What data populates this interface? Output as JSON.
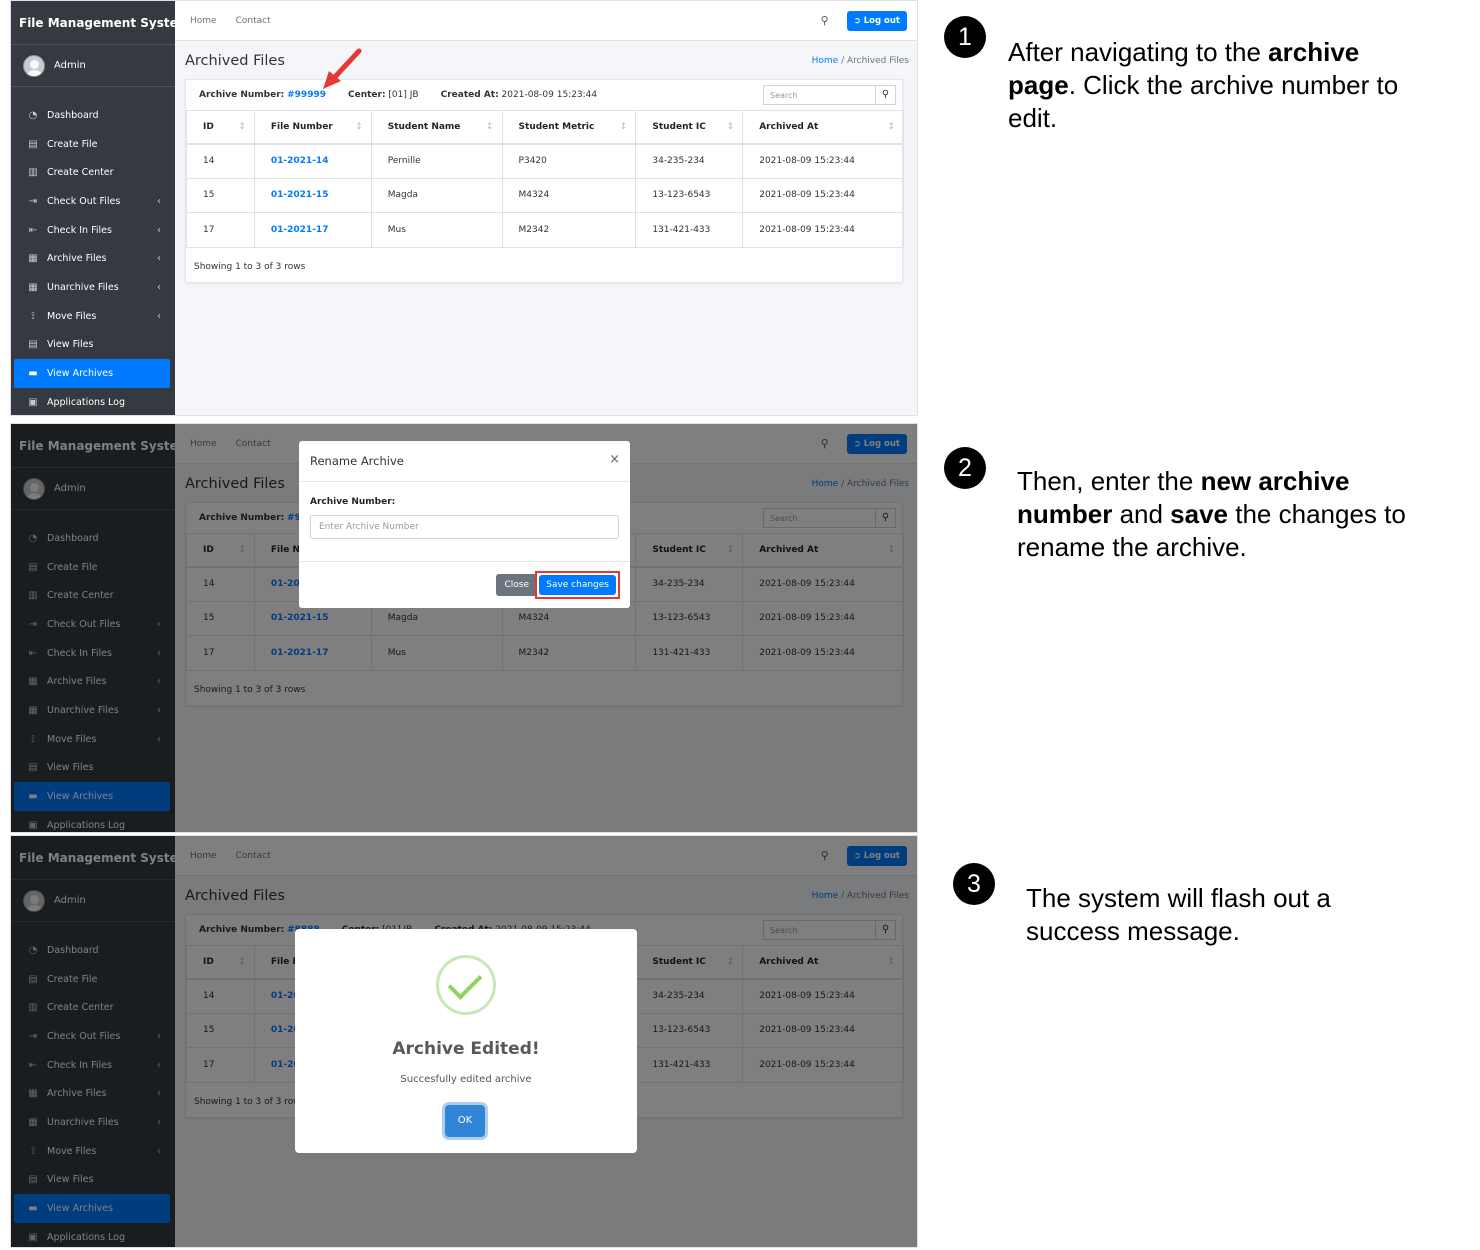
{
  "app": {
    "brand": "File Management System",
    "user": "Admin",
    "home": "Home",
    "contact": "Contact",
    "logout": "Log out"
  },
  "sidebar": [
    {
      "label": "Dashboard",
      "icon": "dashboard-icon",
      "chevron": false
    },
    {
      "label": "Create File",
      "icon": "file-icon",
      "chevron": false
    },
    {
      "label": "Create Center",
      "icon": "building-icon",
      "chevron": false
    },
    {
      "label": "Check Out Files",
      "icon": "file-export-icon",
      "chevron": true
    },
    {
      "label": "Check In Files",
      "icon": "file-import-icon",
      "chevron": true
    },
    {
      "label": "Archive Files",
      "icon": "file-archive-icon",
      "chevron": true
    },
    {
      "label": "Unarchive Files",
      "icon": "file-unarchive-icon",
      "chevron": true
    },
    {
      "label": "Move Files",
      "icon": "dolly-icon",
      "chevron": true
    },
    {
      "label": "View Files",
      "icon": "file-icon",
      "chevron": false
    },
    {
      "label": "View Archives",
      "icon": "archive-icon",
      "chevron": false
    },
    {
      "label": "Applications Log",
      "icon": "clipboard-icon",
      "chevron": false
    }
  ],
  "page": {
    "title": "Archived Files",
    "crumb_home": "Home",
    "crumb_sep": "/",
    "crumb_current": "Archived Files"
  },
  "archive": {
    "label": "Archive Number:",
    "number1": "#99999",
    "number3": "#8888",
    "center_label": "Center:",
    "center_value": "[01] JB",
    "created_label": "Created At:",
    "created_value": "2021-08-09 15:23:44"
  },
  "search": {
    "placeholder": "Search"
  },
  "table": {
    "headers": [
      "ID",
      "File Number",
      "Student Name",
      "Student Metric",
      "Student IC",
      "Archived At"
    ],
    "rows": [
      [
        "14",
        "01-2021-14",
        "Pernille",
        "P3420",
        "34-235-234",
        "2021-08-09 15:23:44"
      ],
      [
        "15",
        "01-2021-15",
        "Magda",
        "M4324",
        "13-123-6543",
        "2021-08-09 15:23:44"
      ],
      [
        "17",
        "01-2021-17",
        "Mus",
        "M2342",
        "131-421-433",
        "2021-08-09 15:23:44"
      ]
    ],
    "footer": "Showing 1 to 3 of 3 rows"
  },
  "modal": {
    "title": "Rename Archive",
    "close_x": "×",
    "label": "Archive Number:",
    "placeholder": "Enter Archive Number",
    "close_btn": "Close",
    "save_btn": "Save changes"
  },
  "success": {
    "title": "Archive Edited!",
    "message": "Succesfully edited archive",
    "ok": "OK"
  },
  "steps": [
    {
      "num": "1",
      "parts": [
        [
          "After navigating to the ",
          false
        ],
        [
          "archive page",
          true
        ],
        [
          ". Click the archive number to edit.",
          false
        ]
      ]
    },
    {
      "num": "2",
      "parts": [
        [
          "Then, enter the ",
          false
        ],
        [
          "new archive number",
          true
        ],
        [
          " and ",
          false
        ],
        [
          "save",
          true
        ],
        [
          " the changes to rename the archive.",
          false
        ]
      ]
    },
    {
      "num": "3",
      "parts": [
        [
          "The system will flash out a success message.",
          false
        ]
      ]
    }
  ]
}
